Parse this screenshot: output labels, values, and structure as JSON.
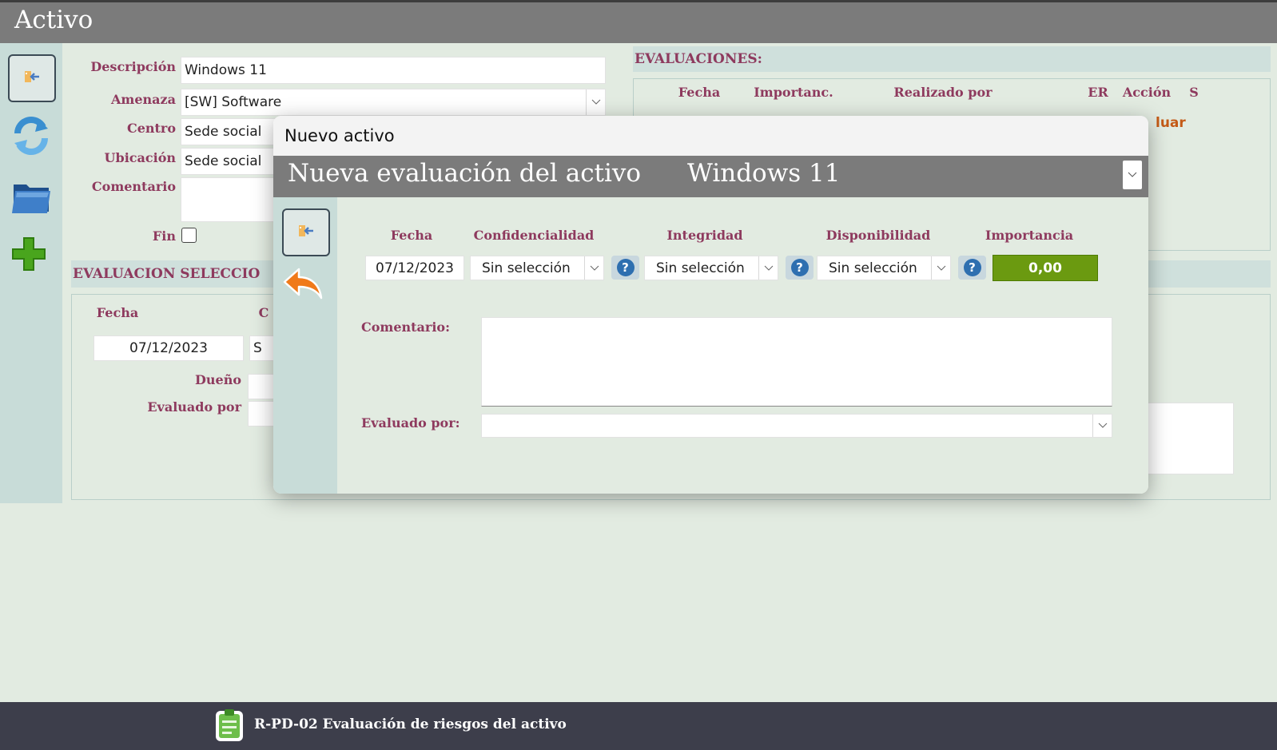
{
  "window": {
    "title": "Activo"
  },
  "sidebar": {
    "icons": [
      "exit-icon",
      "refresh-icon",
      "folder-icon",
      "add-icon"
    ]
  },
  "form": {
    "descripcion_label": "Descripción",
    "descripcion_value": "Windows 11",
    "amenaza_label": "Amenaza",
    "amenaza_value": "[SW] Software",
    "centro_label": "Centro",
    "centro_value": "Sede social",
    "ubicacion_label": "Ubicación",
    "ubicacion_value": "Sede social",
    "comentario_label": "Comentario",
    "fin_label": "Fin",
    "fin_checked": false
  },
  "evaluaciones": {
    "title": "EVALUACIONES:",
    "columns": [
      "Fecha",
      "Importanc.",
      "Realizado por",
      "ER",
      "Acción",
      "S"
    ],
    "row_action_partial": "luar"
  },
  "evaluacion_seleccionada": {
    "title_partial": "EVALUACION SELECCIO",
    "fecha_label": "Fecha",
    "fecha_value": "07/12/2023",
    "col2_label_partial": "C",
    "col2_value_partial": "S",
    "dueno_label": "Dueño",
    "evaluado_label": "Evaluado por"
  },
  "modal": {
    "title": "Nuevo activo",
    "header_label": "Nueva evaluación del activo",
    "header_value": "Windows 11",
    "columns": {
      "fecha": "Fecha",
      "confidencialidad": "Confidencialidad",
      "integridad": "Integridad",
      "disponibilidad": "Disponibilidad",
      "importancia": "Importancia"
    },
    "fecha_value": "07/12/2023",
    "confidencialidad_value": "Sin selección",
    "integridad_value": "Sin selección",
    "disponibilidad_value": "Sin selección",
    "importancia_value": "0,00",
    "help_glyph": "?",
    "comentario_label": "Comentario:",
    "evaluado_label": "Evaluado por:",
    "evaluado_value": ""
  },
  "footer": {
    "record_name": "R-PD-02 Evaluación de riesgos del activo"
  },
  "colors": {
    "label": "#8e3a5e",
    "header": "#7b7b7b",
    "importance": "#6b9a10",
    "footer": "#3d3e4b"
  }
}
